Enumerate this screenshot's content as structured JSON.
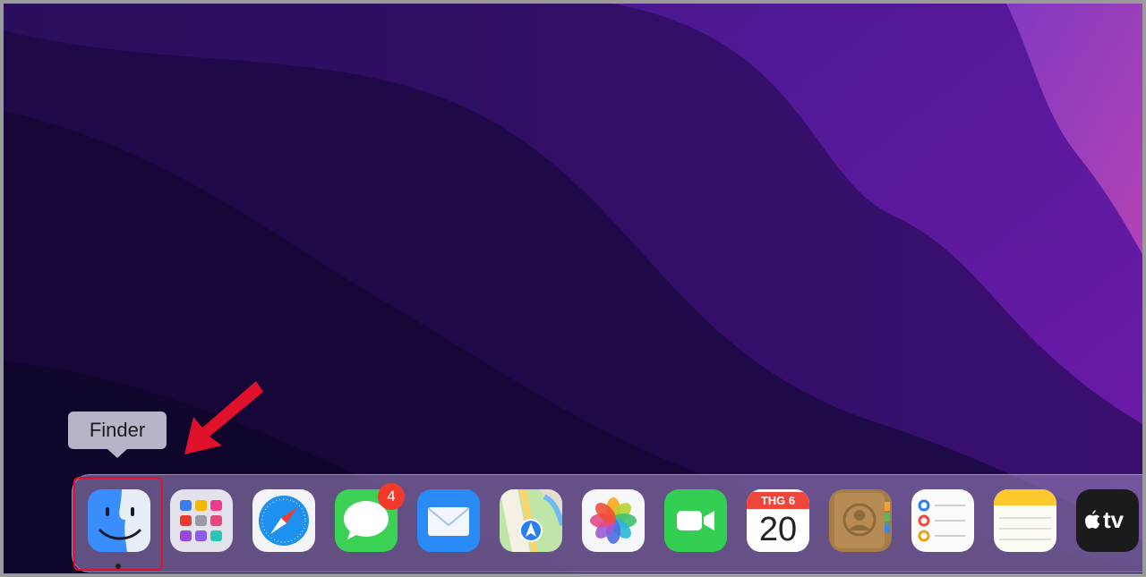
{
  "tooltip": {
    "text": "Finder"
  },
  "dock": {
    "apps": [
      {
        "name": "Finder",
        "icon": "finder-icon",
        "running": true,
        "highlighted": true
      },
      {
        "name": "Launchpad",
        "icon": "launchpad-icon"
      },
      {
        "name": "Safari",
        "icon": "safari-icon"
      },
      {
        "name": "Messages",
        "icon": "messages-icon",
        "badge": "4"
      },
      {
        "name": "Mail",
        "icon": "mail-icon"
      },
      {
        "name": "Maps",
        "icon": "maps-icon"
      },
      {
        "name": "Photos",
        "icon": "photos-icon"
      },
      {
        "name": "FaceTime",
        "icon": "facetime-icon"
      },
      {
        "name": "Calendar",
        "icon": "calendar-icon",
        "month": "THG 6",
        "day": "20"
      },
      {
        "name": "Contacts",
        "icon": "contacts-icon"
      },
      {
        "name": "Reminders",
        "icon": "reminders-icon"
      },
      {
        "name": "Notes",
        "icon": "notes-icon"
      },
      {
        "name": "TV",
        "icon": "tv-icon",
        "label": "tv"
      }
    ]
  },
  "colors": {
    "annotation": "#e0112a",
    "badge": "#f3382c",
    "wallpaper_dark": "#1c0840",
    "wallpaper_light": "#9a3fc0"
  }
}
